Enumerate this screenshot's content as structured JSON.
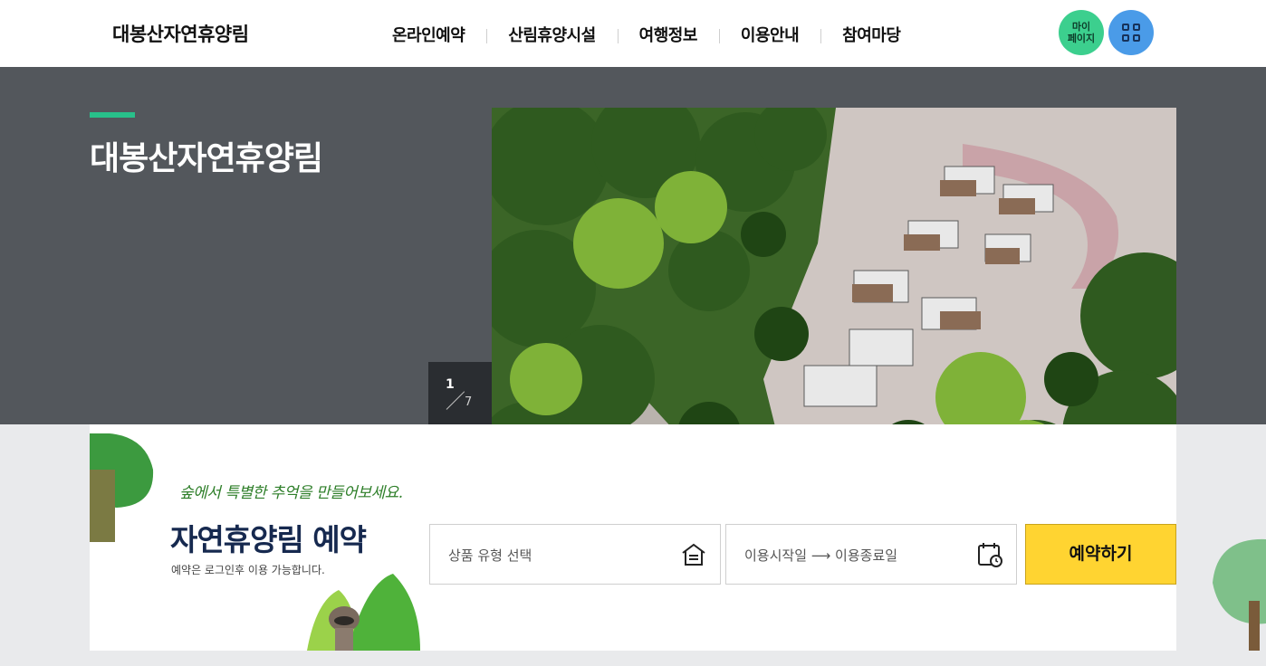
{
  "header": {
    "logo": "대봉산자연휴양림",
    "nav": [
      "온라인예약",
      "산림휴양시설",
      "여행정보",
      "이용안내",
      "참여마당"
    ],
    "mypage_label_line1": "마이",
    "mypage_label_line2": "페이지",
    "menu_icon": "grid-icon"
  },
  "hero": {
    "title": "대봉산자연휴양림",
    "slider": {
      "current": "1",
      "total": "7"
    },
    "prev_icon": "arrow-left-icon",
    "next_icon": "arrow-right-icon"
  },
  "booking": {
    "tagline": "숲에서 특별한 추억을 만들어보세요.",
    "title": "자연휴양림 예약",
    "note": "예약은 로그인후 이용 가능합니다.",
    "product_select": "상품 유형 선택",
    "date_range": "이용시작일 ⟶ 이용종료일",
    "reserve_button": "예약하기"
  },
  "colors": {
    "accent_green": "#28c08a",
    "mypage_bg": "#3ccf8e",
    "menu_bg": "#4a9be8",
    "reserve_yellow": "#ffd431",
    "hero_bg": "#53575c",
    "title_navy": "#16294f"
  }
}
